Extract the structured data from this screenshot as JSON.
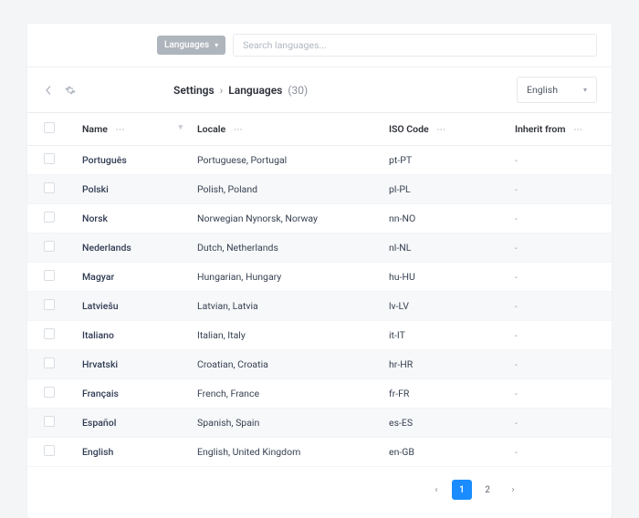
{
  "filter": {
    "label": "Languages"
  },
  "search": {
    "placeholder": "Search languages..."
  },
  "breadcrumb": {
    "settings": "Settings",
    "languages": "Languages",
    "count": "(30)"
  },
  "locale_dropdown": {
    "selected": "English"
  },
  "columns": {
    "name": "Name",
    "locale": "Locale",
    "iso": "ISO Code",
    "inherit": "Inherit from"
  },
  "rows": [
    {
      "name": "Português",
      "locale": "Portuguese, Portugal",
      "iso": "pt-PT",
      "inherit": "-"
    },
    {
      "name": "Polski",
      "locale": "Polish, Poland",
      "iso": "pl-PL",
      "inherit": "-"
    },
    {
      "name": "Norsk",
      "locale": "Norwegian Nynorsk, Norway",
      "iso": "nn-NO",
      "inherit": "-"
    },
    {
      "name": "Nederlands",
      "locale": "Dutch, Netherlands",
      "iso": "nl-NL",
      "inherit": "-"
    },
    {
      "name": "Magyar",
      "locale": "Hungarian, Hungary",
      "iso": "hu-HU",
      "inherit": "-"
    },
    {
      "name": "Latviešu",
      "locale": "Latvian, Latvia",
      "iso": "lv-LV",
      "inherit": "-"
    },
    {
      "name": "Italiano",
      "locale": "Italian, Italy",
      "iso": "it-IT",
      "inherit": "-"
    },
    {
      "name": "Hrvatski",
      "locale": "Croatian, Croatia",
      "iso": "hr-HR",
      "inherit": "-"
    },
    {
      "name": "Français",
      "locale": "French, France",
      "iso": "fr-FR",
      "inherit": "-"
    },
    {
      "name": "Español",
      "locale": "Spanish, Spain",
      "iso": "es-ES",
      "inherit": "-"
    },
    {
      "name": "English",
      "locale": "English, United Kingdom",
      "iso": "en-GB",
      "inherit": "-"
    }
  ],
  "pagination": {
    "page1": "1",
    "page2": "2"
  }
}
